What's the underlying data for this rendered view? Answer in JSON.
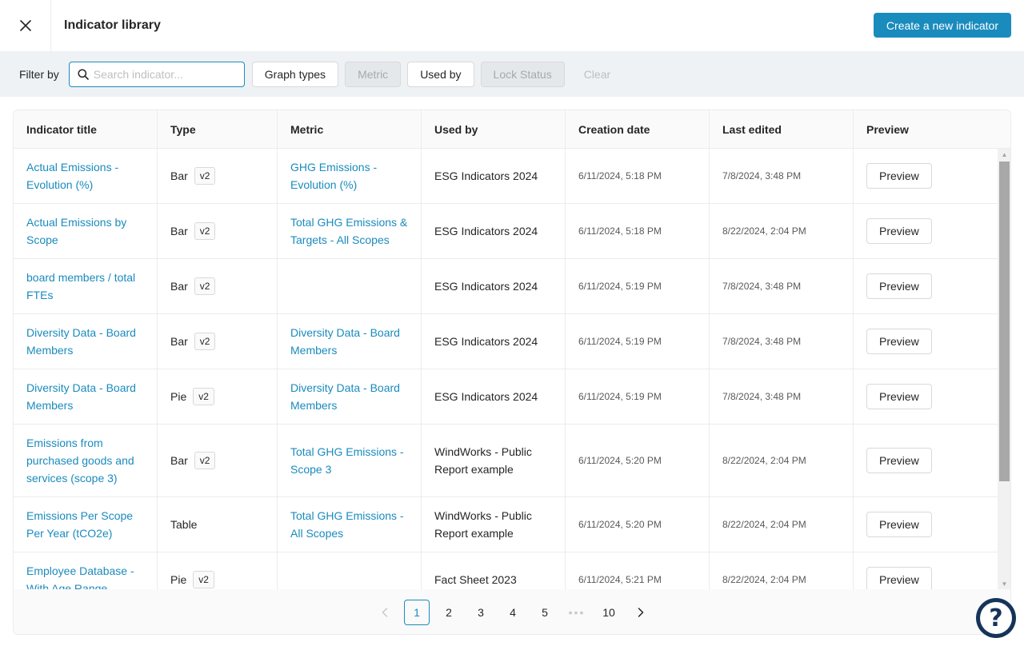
{
  "header": {
    "title": "Indicator library",
    "create_label": "Create a new indicator"
  },
  "filter": {
    "label": "Filter by",
    "search_placeholder": "Search indicator...",
    "graph_types": "Graph types",
    "metric": "Metric",
    "used_by": "Used by",
    "lock_status": "Lock Status",
    "clear": "Clear"
  },
  "table": {
    "columns": [
      "Indicator title",
      "Type",
      "Metric",
      "Used by",
      "Creation date",
      "Last edited",
      "Preview"
    ],
    "rows": [
      {
        "title": "Actual Emissions - Evolution (%)",
        "type": "Bar",
        "version": "v2",
        "metric": "GHG Emissions - Evolution (%)",
        "used_by": "ESG Indicators 2024",
        "created": "6/11/2024, 5:18 PM",
        "edited": "7/8/2024, 3:48 PM",
        "preview": "Preview"
      },
      {
        "title": "Actual Emissions by Scope",
        "type": "Bar",
        "version": "v2",
        "metric": "Total GHG Emissions & Targets - All Scopes",
        "used_by": "ESG Indicators 2024",
        "created": "6/11/2024, 5:18 PM",
        "edited": "8/22/2024, 2:04 PM",
        "preview": "Preview"
      },
      {
        "title": "board members / total FTEs",
        "type": "Bar",
        "version": "v2",
        "metric": "",
        "used_by": "ESG Indicators 2024",
        "created": "6/11/2024, 5:19 PM",
        "edited": "7/8/2024, 3:48 PM",
        "preview": "Preview"
      },
      {
        "title": "Diversity Data - Board Members",
        "type": "Bar",
        "version": "v2",
        "metric": "Diversity Data - Board Members",
        "used_by": "ESG Indicators 2024",
        "created": "6/11/2024, 5:19 PM",
        "edited": "7/8/2024, 3:48 PM",
        "preview": "Preview"
      },
      {
        "title": "Diversity Data - Board Members",
        "type": "Pie",
        "version": "v2",
        "metric": "Diversity Data - Board Members",
        "used_by": "ESG Indicators 2024",
        "created": "6/11/2024, 5:19 PM",
        "edited": "7/8/2024, 3:48 PM",
        "preview": "Preview"
      },
      {
        "title": "Emissions from purchased goods and services (scope 3)",
        "type": "Bar",
        "version": "v2",
        "metric": "Total GHG Emissions - Scope 3",
        "used_by": "WindWorks - Public Report example",
        "created": "6/11/2024, 5:20 PM",
        "edited": "8/22/2024, 2:04 PM",
        "preview": "Preview"
      },
      {
        "title": "Emissions Per Scope Per Year (tCO2e)",
        "type": "Table",
        "version": "",
        "metric": "Total GHG Emissions - All Scopes",
        "used_by": "WindWorks - Public Report example",
        "created": "6/11/2024, 5:20 PM",
        "edited": "8/22/2024, 2:04 PM",
        "preview": "Preview"
      },
      {
        "title": "Employee Database - With Age Range",
        "type": "Pie",
        "version": "v2",
        "metric": "",
        "used_by": "Fact Sheet 2023",
        "created": "6/11/2024, 5:21 PM",
        "edited": "8/22/2024, 2:04 PM",
        "preview": "Preview"
      }
    ]
  },
  "pagination": {
    "pages": [
      "1",
      "2",
      "3",
      "4",
      "5",
      "•••",
      "10"
    ],
    "current": "1"
  },
  "help": {
    "label": "?"
  },
  "colors": {
    "accent": "#1a8bbd",
    "filterbar_bg": "#eef2f5",
    "help_bg": "#16345a"
  },
  "icons": {
    "close": "close-icon",
    "search": "search-icon",
    "prev": "chevron-left-icon",
    "next": "chevron-right-icon",
    "help": "help-icon"
  }
}
